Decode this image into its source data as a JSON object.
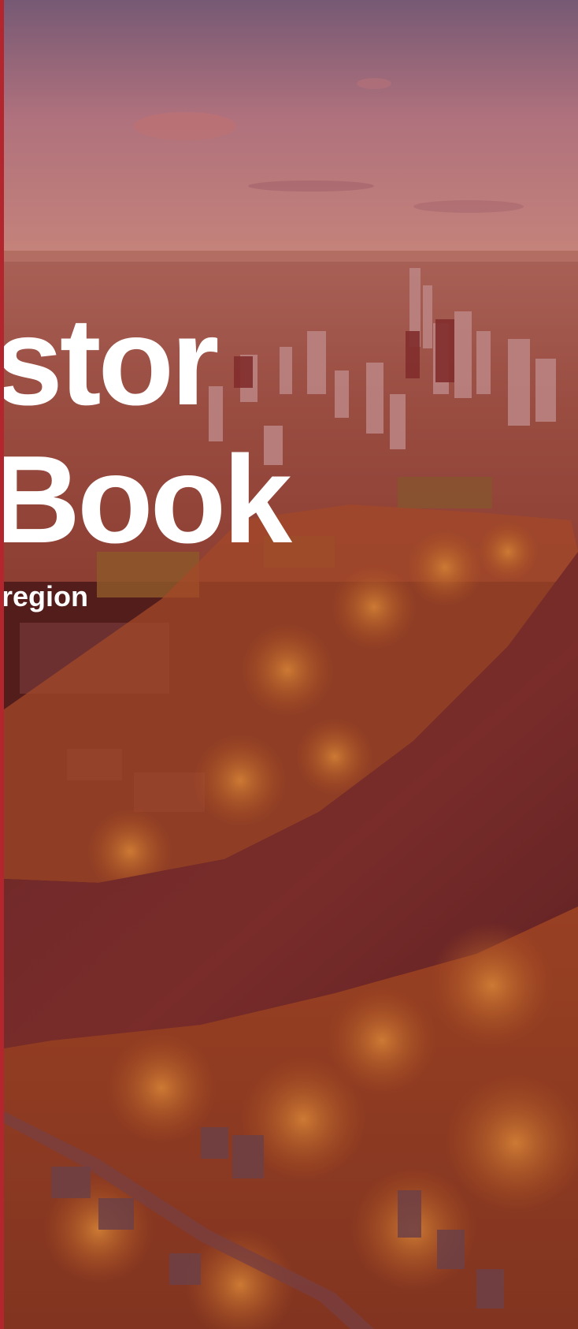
{
  "cover": {
    "title_line_1": "stor",
    "title_line_2": "Book",
    "subtitle": "region",
    "accent_color": "#b3262d",
    "photo_description_icon": "aerial-city-river-photo"
  }
}
